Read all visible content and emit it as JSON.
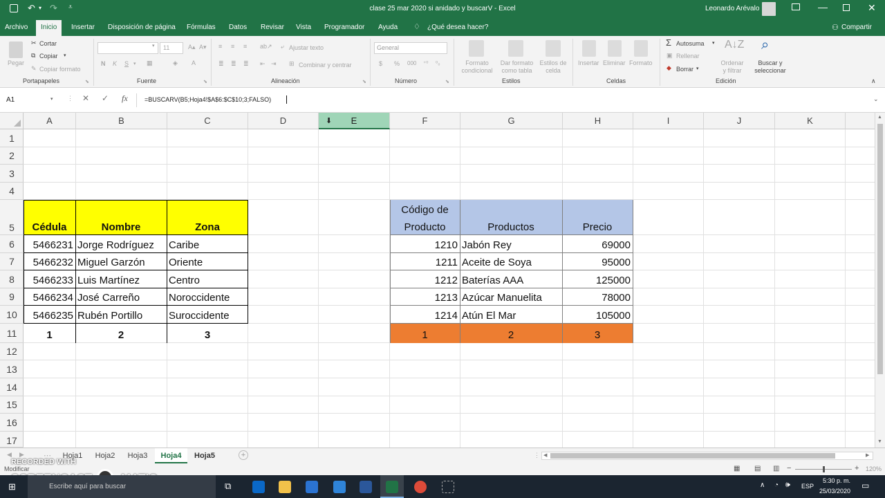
{
  "window": {
    "title": "clase 25 mar 2020 si anidado y buscarV  -  Excel",
    "user": "Leonardo Arévalo"
  },
  "ribbon_tabs": [
    "Archivo",
    "Inicio",
    "Insertar",
    "Disposición de página",
    "Fórmulas",
    "Datos",
    "Revisar",
    "Vista",
    "Programador",
    "Ayuda",
    "¿Qué desea hacer?"
  ],
  "share_label": "Compartir",
  "ribbon": {
    "portapapeles": {
      "label": "Portapapeles",
      "pegar": "Pegar",
      "cortar": "Cortar",
      "copiar": "Copiar",
      "copiar_formato": "Copiar formato"
    },
    "fuente": {
      "label": "Fuente",
      "size": "11"
    },
    "alineacion": {
      "label": "Alineación",
      "ajustar": "Ajustar texto",
      "combinar": "Combinar y centrar"
    },
    "numero": {
      "label": "Número",
      "format": "General"
    },
    "estilos": {
      "label": "Estilos",
      "formato_condicional": "Formato condicional",
      "dar_formato": "Dar formato como tabla",
      "estilos_celda": "Estilos de celda"
    },
    "celdas": {
      "label": "Celdas",
      "insertar": "Insertar",
      "eliminar": "Eliminar",
      "formato": "Formato"
    },
    "edicion": {
      "label": "Edición",
      "autosuma": "Autosuma",
      "rellenar": "Rellenar",
      "borrar": "Borrar",
      "ordenar": "Ordenar y filtrar",
      "buscar": "Buscar y seleccionar"
    }
  },
  "formula_bar": {
    "name_box": "A1",
    "formula": "=BUSCARV(B5;Hoja4!$A$6:$C$10;3;FALSO)"
  },
  "columns": [
    "A",
    "B",
    "C",
    "D",
    "E",
    "F",
    "G",
    "H",
    "I",
    "J",
    "K"
  ],
  "rows": [
    "1",
    "2",
    "3",
    "4",
    "5",
    "6",
    "7",
    "8",
    "9",
    "10",
    "11",
    "12",
    "13",
    "14",
    "15",
    "16",
    "17"
  ],
  "table_left": {
    "headers": [
      "Cédula",
      "Nombre",
      "Zona"
    ],
    "rows": [
      [
        "5466231",
        "Jorge Rodríguez",
        "Caribe"
      ],
      [
        "5466232",
        "Miguel Garzón",
        "Oriente"
      ],
      [
        "5466233",
        "Luis Martínez",
        "Centro"
      ],
      [
        "5466234",
        "José Carreño",
        "Noroccidente"
      ],
      [
        "5466235",
        "Rubén Portillo",
        "Suroccidente"
      ]
    ],
    "footer": [
      "1",
      "2",
      "3"
    ],
    "header_color": "#ffff00"
  },
  "table_right": {
    "header_f_line1": "Código de",
    "header_f_line2": "Producto",
    "header_g": "Productos",
    "header_h": "Precio",
    "rows": [
      [
        "1210",
        "Jabón Rey",
        "69000"
      ],
      [
        "1211",
        "Aceite de Soya",
        "95000"
      ],
      [
        "1212",
        "Baterías AAA",
        "125000"
      ],
      [
        "1213",
        "Azúcar Manuelita",
        "78000"
      ],
      [
        "1214",
        "Atún El Mar",
        "105000"
      ]
    ],
    "footer": [
      "1",
      "2",
      "3"
    ],
    "header_color": "#b4c6e7",
    "footer_color": "#ed7d31"
  },
  "sheets": [
    "Hoja1",
    "Hoja2",
    "Hoja3",
    "Hoja4",
    "Hoja5"
  ],
  "active_sheet": "Hoja4",
  "status": {
    "mode": "Modificar",
    "zoom": "120%"
  },
  "watermark": {
    "line1": "RECORDED WITH",
    "line2": "SCREENCAST",
    "line3": "MATIC"
  },
  "taskbar": {
    "search_placeholder": "Escribe aquí para buscar",
    "lang": "ESP",
    "time": "5:30 p. m.",
    "date": "25/03/2020"
  },
  "colors": {
    "excel_green": "#217346",
    "selected_col": "#9fd5b7"
  }
}
